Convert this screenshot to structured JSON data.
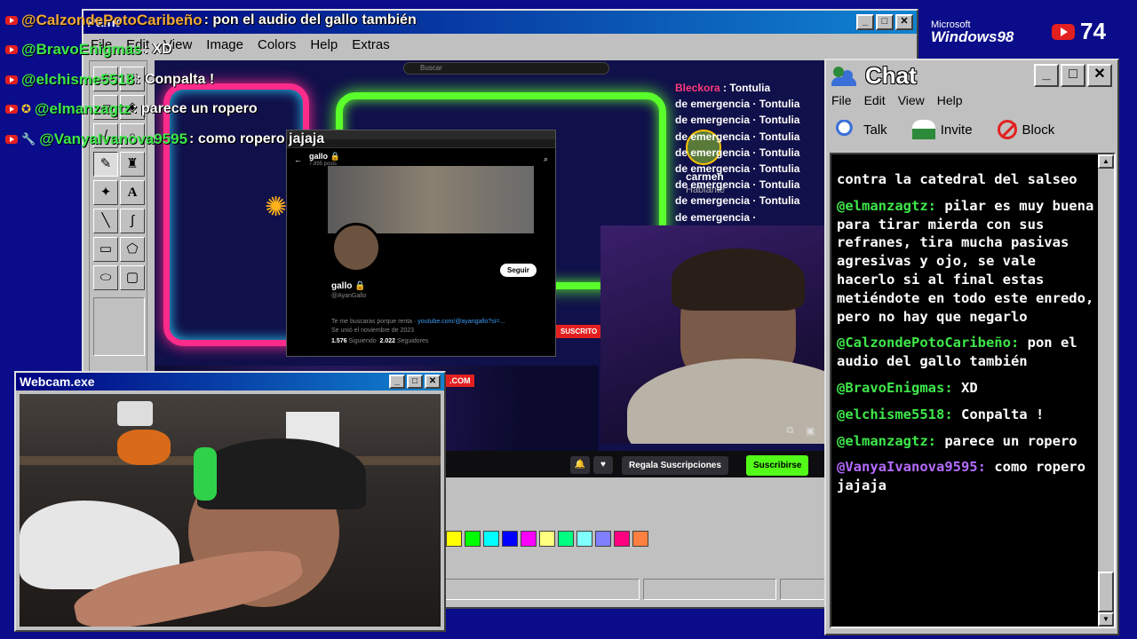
{
  "overlay_chat": [
    {
      "user": "@CalzondePotoCaribeño",
      "msg": ": pon el audio del gallo también",
      "color": "orange",
      "extra": ""
    },
    {
      "user": "@BravoEnigmas",
      "msg": ": XD",
      "color": "green",
      "extra": ""
    },
    {
      "user": "@elchisme5518",
      "msg": ": Conpalta !",
      "color": "green",
      "extra": ""
    },
    {
      "user": "@elmanzagtz",
      "msg": ": parece un ropero",
      "color": "green",
      "extra": "✪"
    },
    {
      "user": "@VanyaIvanova9595",
      "msg": ": como ropero jajaja",
      "color": "green",
      "extra": "🔧"
    }
  ],
  "paint": {
    "title": "Paint",
    "menus": [
      "File",
      "Edit",
      "View",
      "Image",
      "Colors",
      "Help",
      "Extras"
    ],
    "palette": [
      "#ffff00",
      "#00ff00",
      "#00ffff",
      "#0000ff",
      "#ff00ff",
      "#ffff80",
      "#00ff80",
      "#80ffff",
      "#8080ff",
      "#ff0080",
      "#ff8040"
    ]
  },
  "stream": {
    "search_placeholder": "Buscar",
    "x_profile": {
      "name": "gallo 🔒",
      "posts": "7.895 posts",
      "follow": "Seguir",
      "handle": "@AyanGallo",
      "link_prefix": "Te me buscaras porque renta",
      "link": "youtube.com/@ayangallo?si=...",
      "joined": "Se unió el noviembre de 2023",
      "following_num": "1.576",
      "following_label": "Siguiendo",
      "followers_num": "2.022",
      "followers_label": "Seguidores"
    },
    "right_chat": [
      {
        "user": "Bleckora",
        "msg": "Tontulia"
      },
      {
        "user": "",
        "msg": "de emergencia · Tontulia"
      },
      {
        "user": "",
        "msg": "de emergencia · Tontulia"
      },
      {
        "user": "",
        "msg": "de emergencia · Tontulia"
      },
      {
        "user": "",
        "msg": "de emergencia · Tontulia"
      },
      {
        "user": "",
        "msg": "de emergencia · Tontulia"
      },
      {
        "user": "",
        "msg": "de emergencia · Tontulia"
      },
      {
        "user": "",
        "msg": "de emergencia · Tontulia"
      },
      {
        "user": "",
        "msg": "de emergencia ·"
      }
    ],
    "speaker": {
      "name": "carmen",
      "role": "Hablante"
    },
    "suscrito": "SUSCRITO",
    "com": ".COM",
    "gift_button": "Regala Suscripciones",
    "sub_button": "Suscribirse"
  },
  "win98": {
    "microsoft": "Microsoft",
    "windows": "Windows98"
  },
  "yt_count": "74",
  "chat": {
    "title": "Chat",
    "menus": [
      "File",
      "Edit",
      "View",
      "Help"
    ],
    "tools": [
      "Talk",
      "Invite",
      "Block"
    ],
    "messages": [
      {
        "user": "",
        "text": "contra la catedral del salseo"
      },
      {
        "user": "@elmanzagtz:",
        "text": " pilar es muy buena para tirar mierda con sus refranes, tira mucha pasivas agresivas y ojo, se vale hacerlo si al final estas metiéndote en todo este enredo, pero no hay que negarlo"
      },
      {
        "user": "@CalzondePotoCaribeño:",
        "text": " pon el audio del gallo también"
      },
      {
        "user": "@BravoEnigmas:",
        "text": " XD"
      },
      {
        "user": "@elchisme5518:",
        "text": " Conpalta !"
      },
      {
        "user": "@elmanzagtz:",
        "text": " parece un ropero"
      },
      {
        "user": "@VanyaIvanova9595:",
        "text": " como ropero jajaja",
        "purple": true
      }
    ]
  },
  "webcam": {
    "title": "Webcam.exe"
  }
}
